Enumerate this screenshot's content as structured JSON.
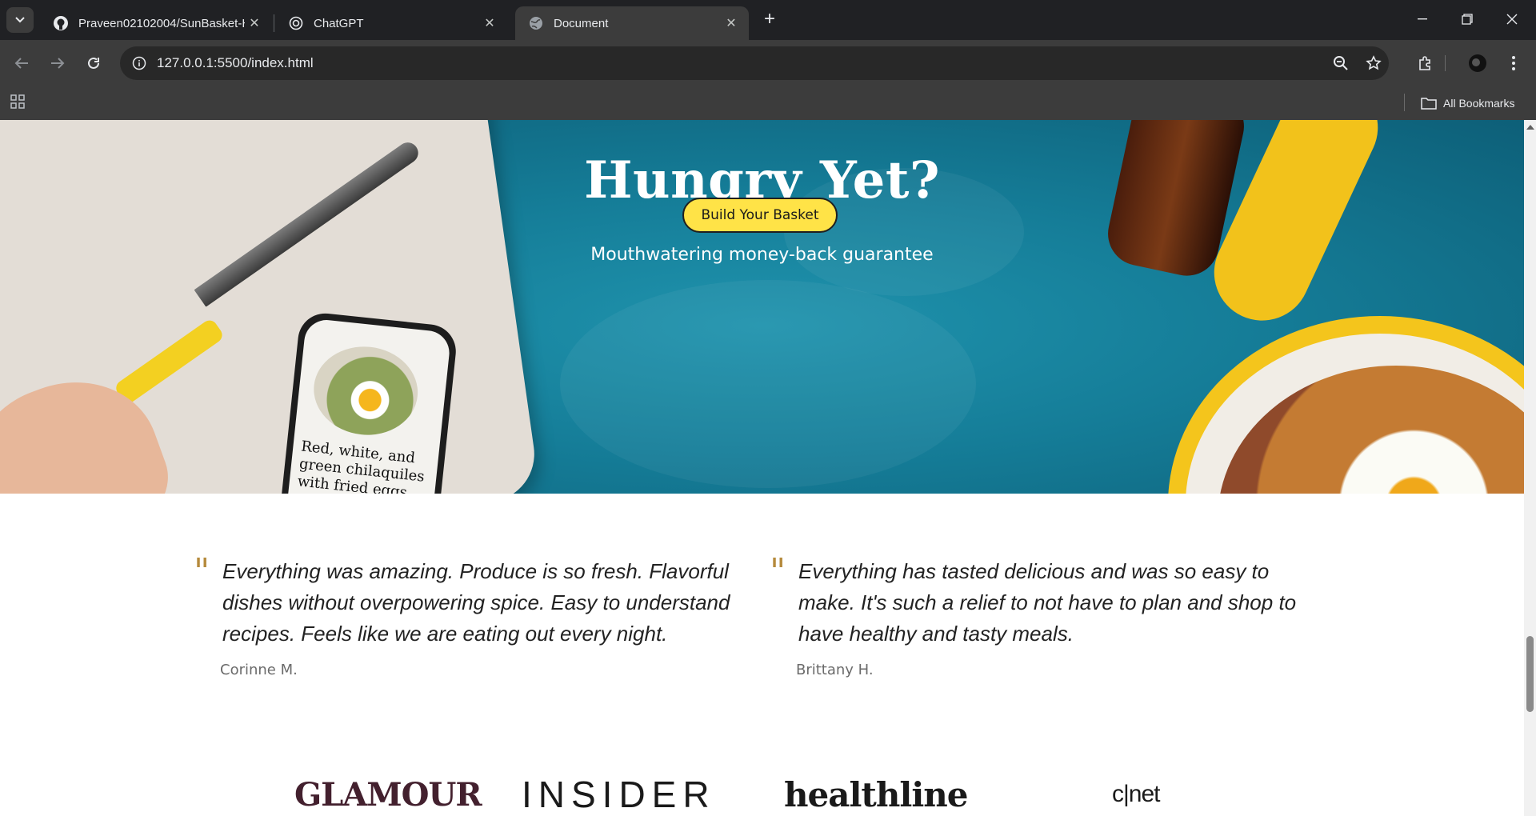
{
  "browser": {
    "tabs": [
      {
        "title": "Praveen02102004/SunBasket-H",
        "icon": "github-icon",
        "active": false
      },
      {
        "title": "ChatGPT",
        "icon": "chatgpt-icon",
        "active": false
      },
      {
        "title": "Document",
        "icon": "globe-icon",
        "active": true
      }
    ],
    "url": "127.0.0.1:5500/index.html",
    "bookmarks_label": "All Bookmarks"
  },
  "hero": {
    "title": "Hungry Yet?",
    "button_label": "Build Your Basket",
    "subtitle": "Mouthwatering money-back guarantee",
    "phone_caption": "Red, white, and green chilaquiles with fried eggs",
    "colors": {
      "background": "#157d98",
      "button": "#ffe347"
    }
  },
  "testimonials": [
    {
      "quote": "Everything was amazing. Produce is so fresh. Flavorful dishes without overpowering spice. Easy to understand recipes. Feels like we are eating out every night.",
      "author": "Corinne M."
    },
    {
      "quote": "Everything has tasted delicious and was so easy to make. It's such a relief to not have to plan and shop to have healthy and tasty meals.",
      "author": "Brittany H."
    }
  ],
  "press_logos": [
    "GLAMOUR",
    "INSIDER",
    "healthline",
    "c|net"
  ]
}
